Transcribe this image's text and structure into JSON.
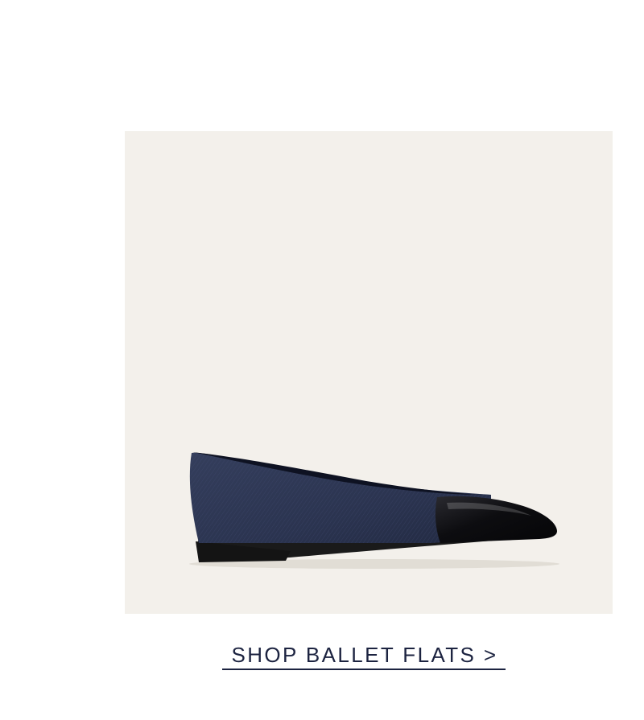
{
  "product": {
    "image_alt": "Denim ballet flat with black patent cap toe",
    "colors": {
      "background": "#f3f0eb",
      "denim": "#2b3450",
      "cap_toe": "#0d0d10",
      "sole": "#1a1a1a"
    }
  },
  "cta": {
    "label": "SHOP BALLET FLATS >",
    "color": "#1c2340"
  }
}
